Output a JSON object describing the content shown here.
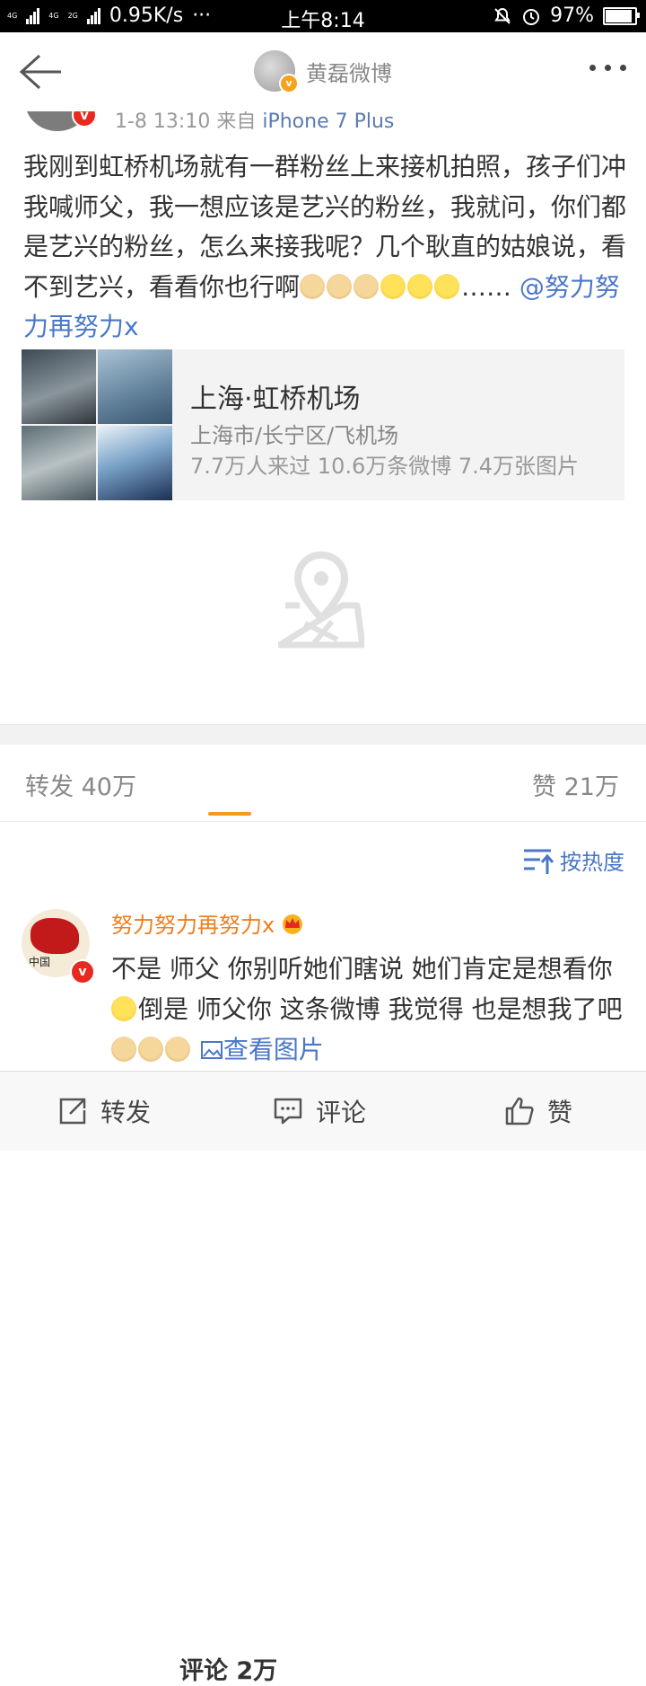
{
  "status_bar": {
    "network_label_1": "4G",
    "network_label_2": "4G",
    "network_label_3": "2G",
    "speed": "0.95K/s",
    "dots": "···",
    "time": "上午8:14",
    "battery": "97%",
    "battery_level": 0.97
  },
  "nav": {
    "title": "黄磊微博",
    "verified_mark": "v"
  },
  "post": {
    "verified_mark": "v",
    "time": "1-8 13:10",
    "source_prefix": "来自",
    "source": "iPhone 7 Plus",
    "text": "我刚到虹桥机场就有一群粉丝上来接机拍照，孩子们冲我喊师父，我一想应该是艺兴的粉丝，我就问，你们都是艺兴的粉丝，怎么来接我呢？几个耿直的姑娘说，看不到艺兴，看看你也行啊",
    "ellipsis": "……",
    "mention": "@努力努力再努力x"
  },
  "location": {
    "name": "上海·虹桥机场",
    "address": "上海市/长宁区/飞机场",
    "stats": "7.7万人来过 10.6万条微博 7.4万张图片"
  },
  "tabs": {
    "repost": "转发 40万",
    "comment": "评论 2万",
    "like": "赞 21万"
  },
  "sort": {
    "label": "按热度"
  },
  "comment": {
    "username": "努力努力再努力x",
    "verified_mark": "v",
    "avatar_text": "中国",
    "text_1": "不是 师父 你别听她们瞎说 她们肯定是想看你",
    "text_2": "倒是 师父你 这条微博 我觉得 也是想我了吧",
    "view_image": "查看图片"
  },
  "bottom_bar": {
    "repost": "转发",
    "comment": "评论",
    "like": "赞"
  },
  "colors": {
    "accent_orange": "#f39a1f",
    "link_blue": "#4a77c9",
    "username_orange": "#f07d1a",
    "verified_red": "#e7291f"
  }
}
